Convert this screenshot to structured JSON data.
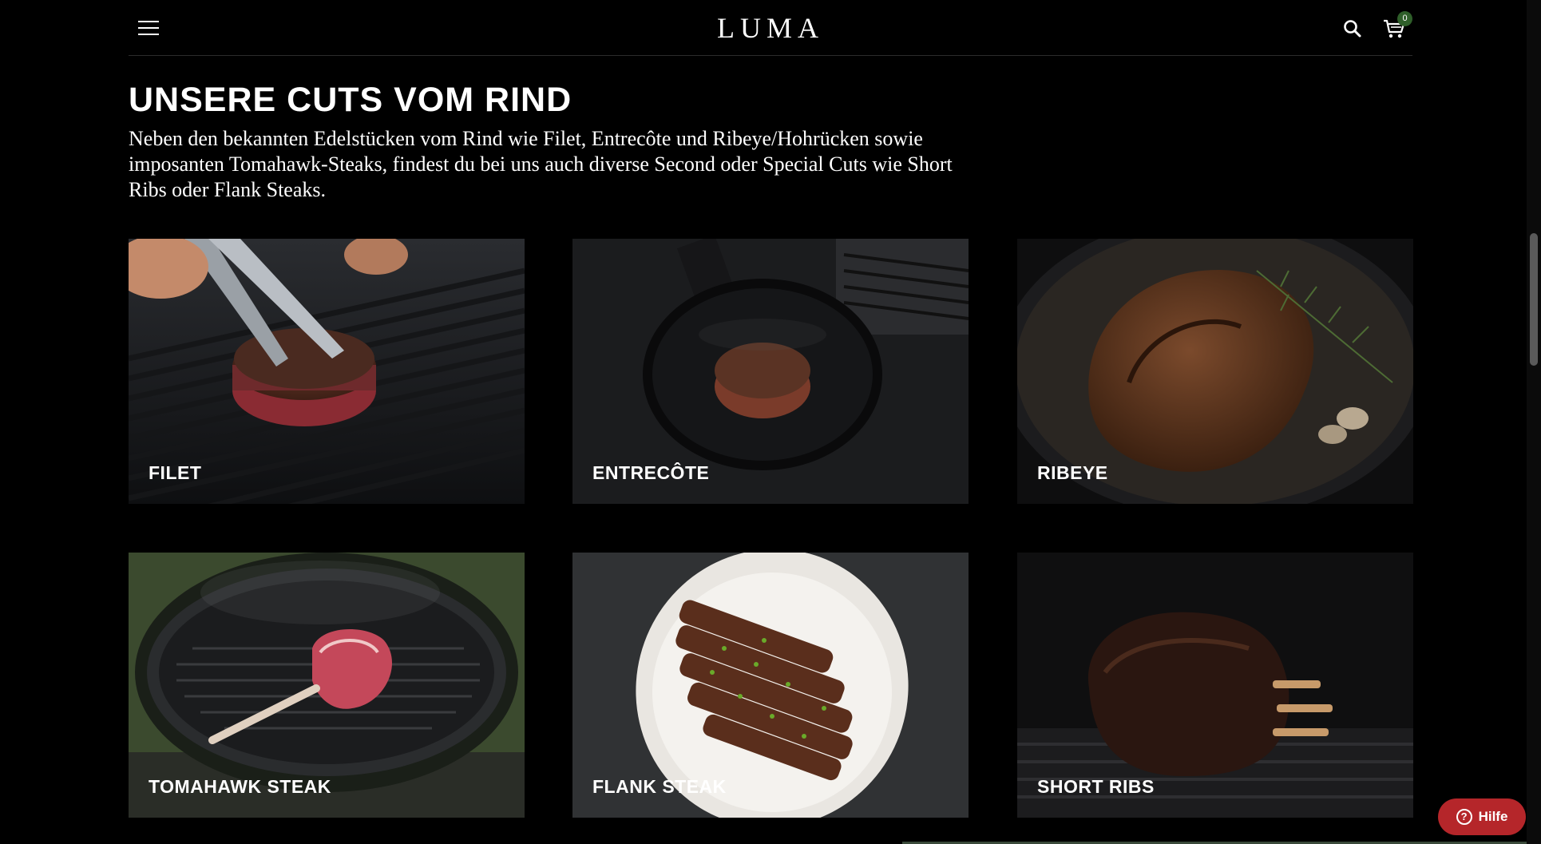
{
  "header": {
    "logo": "LUMA",
    "cart_count": "0"
  },
  "section": {
    "title": "UNSERE CUTS VOM RIND",
    "intro": "Neben den bekannten Edelstücken vom Rind wie Filet, Entrecôte und Ribeye/Hohrücken sowie imposanten Tomahawk-Steaks, findest du bei uns auch diverse Second oder Special Cuts wie Short Ribs oder Flank Steaks."
  },
  "cuts": [
    {
      "label": "FILET"
    },
    {
      "label": "ENTRECÔTE"
    },
    {
      "label": "RIBEYE"
    },
    {
      "label": "TOMAHAWK STEAK"
    },
    {
      "label": "FLANK STEAK"
    },
    {
      "label": "SHORT RIBS"
    }
  ],
  "help": {
    "label": "Hilfe",
    "icon_glyph": "?"
  },
  "colors": {
    "help_button": "#b5262a",
    "cart_badge": "#2f5f2a",
    "background": "#000000"
  }
}
